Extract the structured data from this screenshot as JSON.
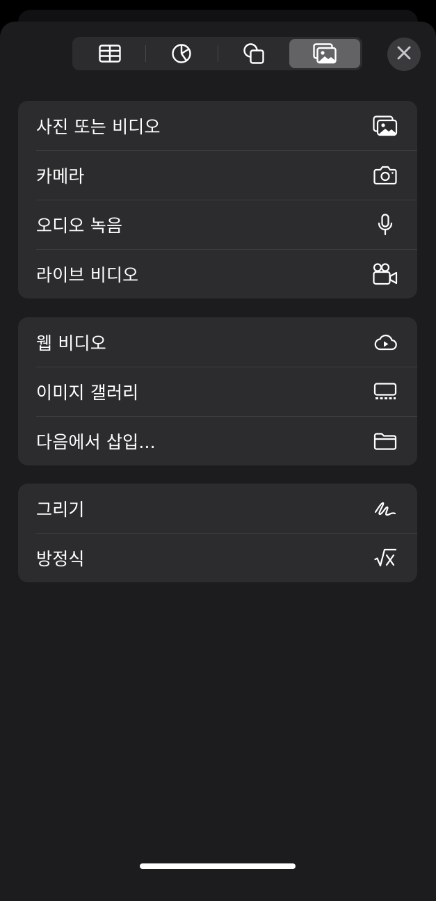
{
  "toolbar": {
    "tabs": [
      {
        "icon": "table-icon",
        "selected": false
      },
      {
        "icon": "chart-icon",
        "selected": false
      },
      {
        "icon": "shapes-icon",
        "selected": false
      },
      {
        "icon": "media-icon",
        "selected": true
      }
    ],
    "close_icon": "close-icon"
  },
  "groups": [
    {
      "items": [
        {
          "label": "사진 또는 비디오",
          "icon": "photo-library-icon"
        },
        {
          "label": "카메라",
          "icon": "camera-icon"
        },
        {
          "label": "오디오 녹음",
          "icon": "microphone-icon"
        },
        {
          "label": "라이브 비디오",
          "icon": "video-camera-icon"
        }
      ]
    },
    {
      "items": [
        {
          "label": "웹 비디오",
          "icon": "cloud-play-icon"
        },
        {
          "label": "이미지 갤러리",
          "icon": "image-gallery-icon"
        },
        {
          "label": "다음에서 삽입...",
          "icon": "folder-icon"
        }
      ]
    },
    {
      "items": [
        {
          "label": "그리기",
          "icon": "drawing-scribble-icon"
        },
        {
          "label": "방정식",
          "icon": "square-root-x-icon"
        }
      ]
    }
  ],
  "colors": {
    "sheet": "#1c1c1e",
    "group": "#2c2c2e",
    "selected_tab": "#636366",
    "text": "#ffffff"
  }
}
